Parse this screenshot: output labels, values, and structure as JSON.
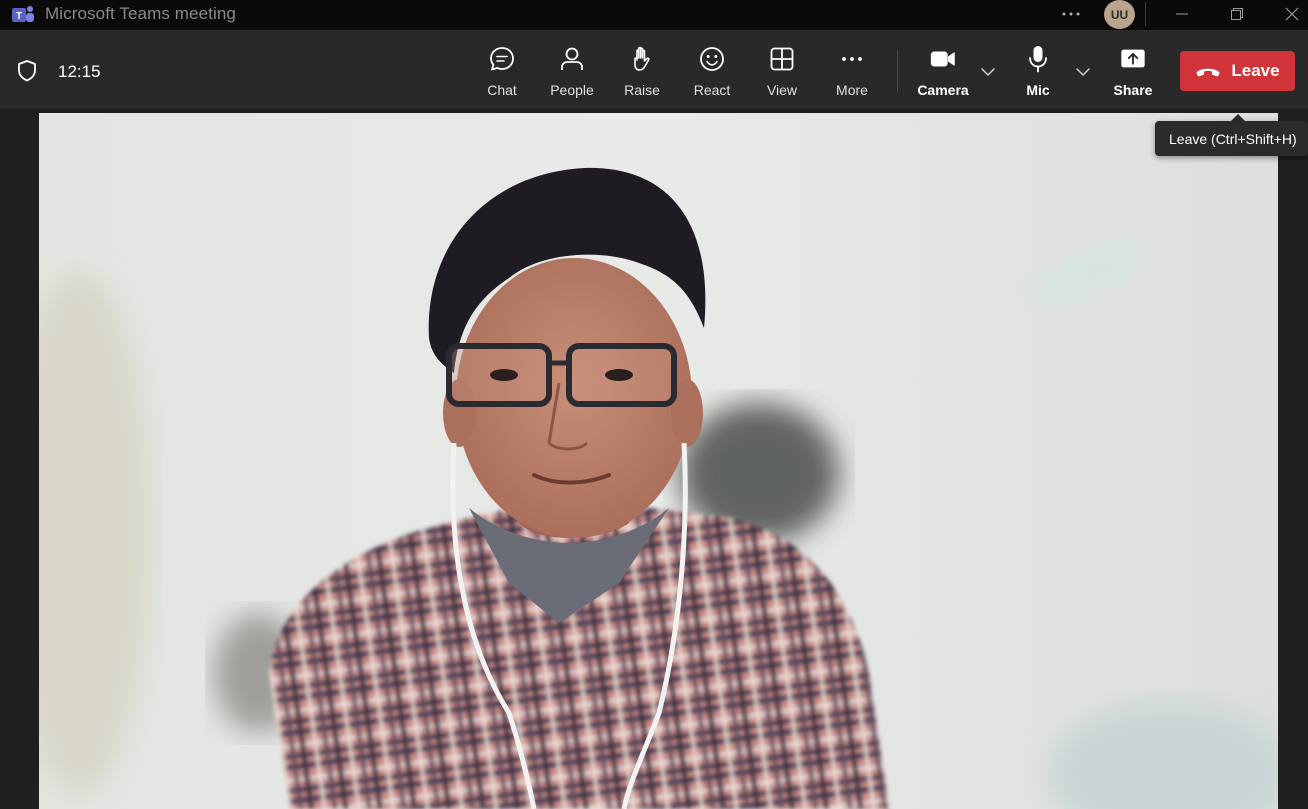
{
  "window": {
    "title": "Microsoft Teams meeting",
    "avatar_initials": "UU"
  },
  "meeting": {
    "elapsed_time": "12:15"
  },
  "toolbar": {
    "chat_label": "Chat",
    "people_label": "People",
    "raise_label": "Raise",
    "react_label": "React",
    "view_label": "View",
    "more_label": "More",
    "camera_label": "Camera",
    "mic_label": "Mic",
    "share_label": "Share",
    "leave_label": "Leave"
  },
  "tooltip": {
    "text": "Leave (Ctrl+Shift+H)"
  },
  "colors": {
    "leave_button": "#d13438",
    "toolbar_bg": "#292929",
    "titlebar_bg": "#0a0a0a",
    "teams_purple": "#6264a7"
  }
}
